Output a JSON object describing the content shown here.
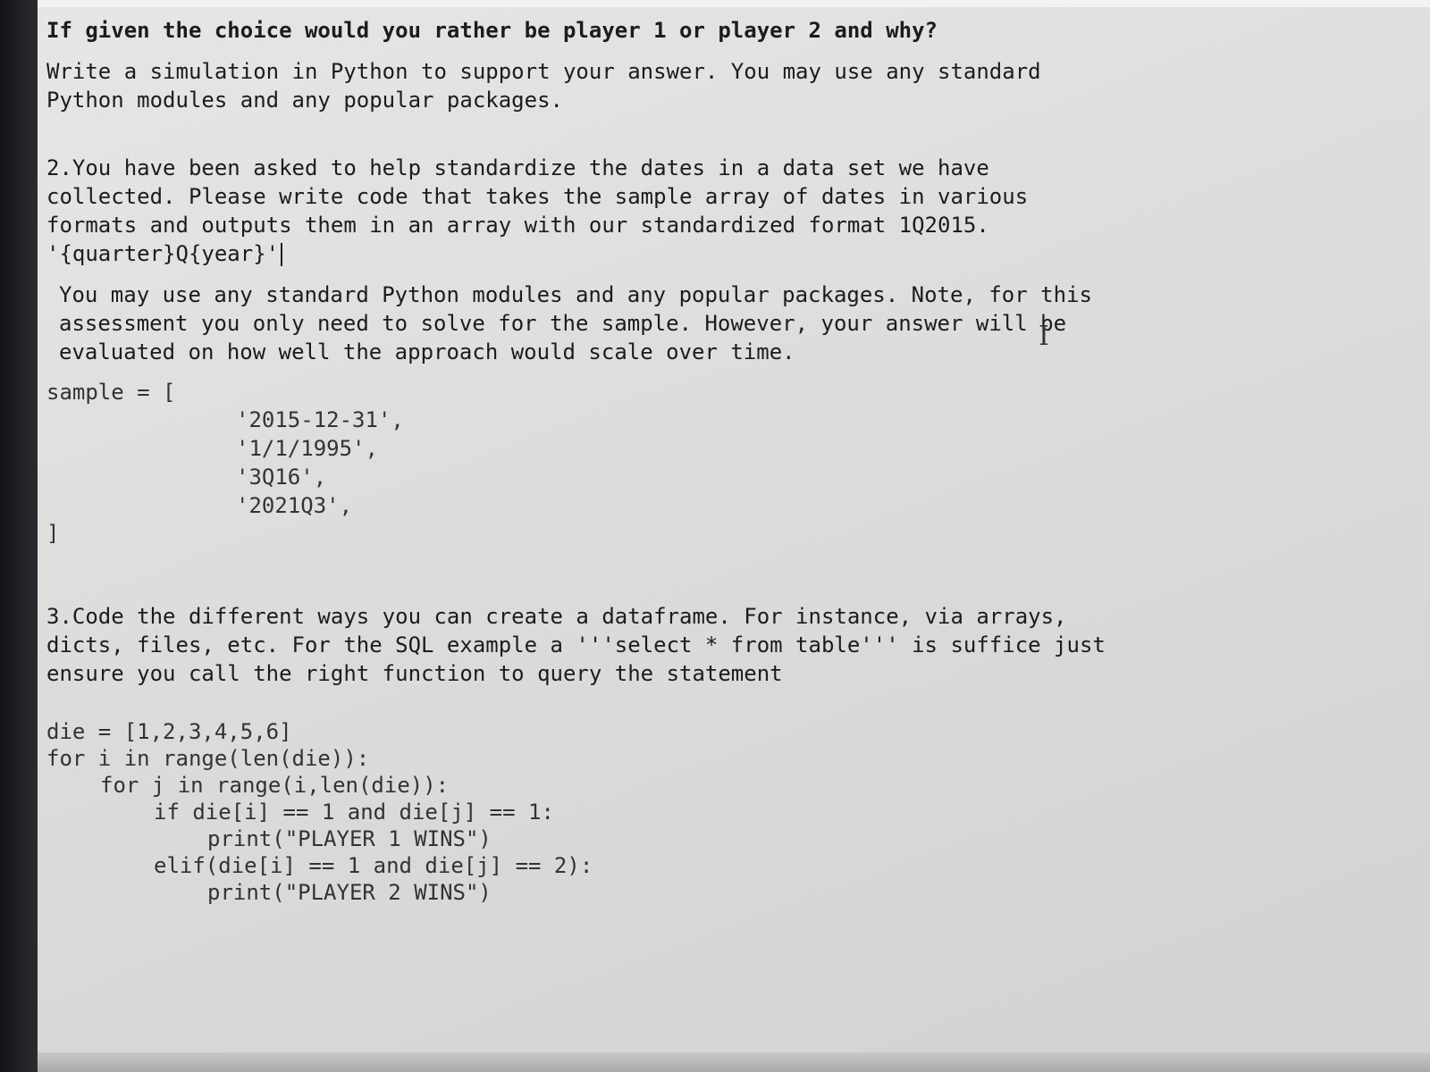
{
  "question1": {
    "prompt": "If given the choice would you rather be player 1 or player 2 and why?",
    "instructions": "Write a simulation in Python to support your answer. You may use any standard Python modules and any popular packages."
  },
  "question2": {
    "body": "2.You have been asked to help standardize the dates in a data set we have collected. Please write code that takes the sample array of dates in various formats and outputs them in an array with our standardized format 1Q2015. '{quarter}Q{year}'",
    "note": "You may use any standard Python modules and any popular packages. Note, for this assessment you only need to solve for the sample. However, your answer will be evaluated on how well the approach would scale over time.",
    "sample_open": "sample = [",
    "sample_items": [
      "'2015-12-31',",
      "'1/1/1995',",
      "'3Q16',",
      "'2021Q3',"
    ],
    "sample_close": "]"
  },
  "question3": {
    "body": "3.Code the different ways you can create a dataframe. For instance, via arrays, dicts, files, etc. For the SQL example a '''select * from table''' is suffice just ensure you call the right function to query the statement"
  },
  "code": {
    "lines": [
      "die = [1,2,3,4,5,6]",
      "for i in range(len(die)):",
      "for j in range(i,len(die)):",
      "if die[i] == 1 and die[j] == 1:",
      "print(\"PLAYER 1 WINS\")",
      "elif(die[i] == 1 and die[j] == 2):",
      "print(\"PLAYER 2 WINS\")"
    ]
  },
  "cursor": {
    "icon": "text-cursor-icon"
  }
}
